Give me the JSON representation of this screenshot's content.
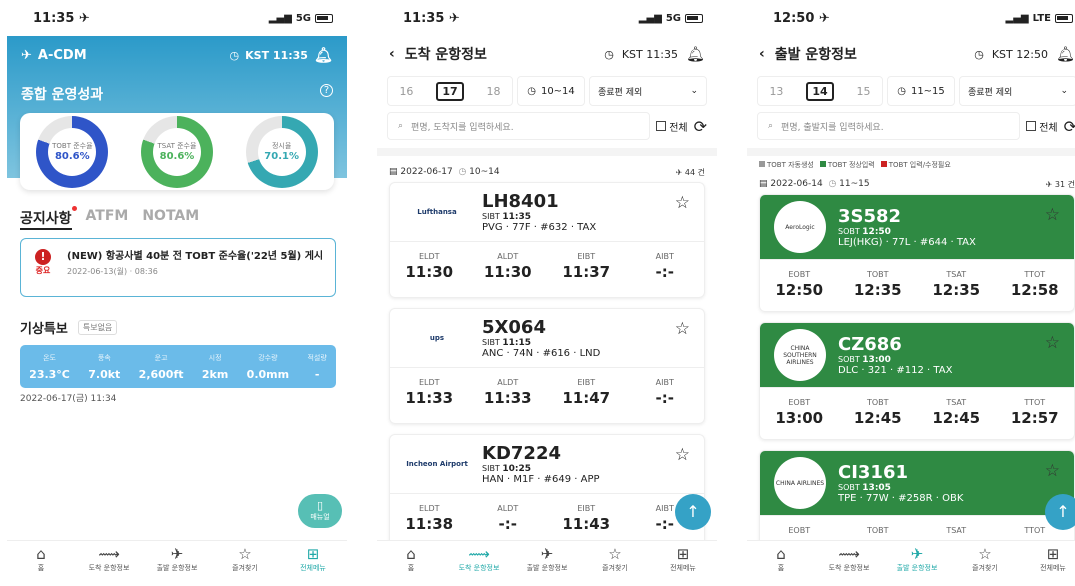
{
  "p1": {
    "status": {
      "time": "11:35 ✈",
      "signal": "5G"
    },
    "hero": {
      "logo": "A-CDM",
      "clock": "KST 11:35",
      "title": "종합 운영성과"
    },
    "donuts": [
      {
        "label": "TOBT 준수율",
        "value": "80.6%",
        "color": "#2f55c8",
        "pct": 80.6
      },
      {
        "label": "TSAT 준수율",
        "value": "80.6%",
        "color": "#4cb25c",
        "pct": 80.6
      },
      {
        "label": "정시율",
        "value": "70.1%",
        "color": "#35a8b2",
        "pct": 70.1
      }
    ],
    "tabs": [
      "공지사항",
      "ATFM",
      "NOTAM"
    ],
    "notice": {
      "badge": "중요",
      "title": "(NEW) 항공사별 40분 전 TOBT 준수율('22년 5월) 게시",
      "date": "2022-06-13(월) · 08:36"
    },
    "weather": {
      "title": "기상특보",
      "status": "특보없음",
      "items": [
        {
          "k": "온도",
          "v": "23.3°C"
        },
        {
          "k": "풍속",
          "v": "7.0kt"
        },
        {
          "k": "운고",
          "v": "2,600ft"
        },
        {
          "k": "시정",
          "v": "2km"
        },
        {
          "k": "강수량",
          "v": "0.0mm"
        },
        {
          "k": "적설량",
          "v": "-"
        }
      ],
      "time": "2022-06-17(금) 11:34"
    },
    "manual": "매뉴얼"
  },
  "nav": [
    "홈",
    "도착 운항정보",
    "출발 운항정보",
    "즐겨찾기",
    "전체메뉴"
  ],
  "p2": {
    "status": {
      "time": "11:35 ✈",
      "signal": "5G"
    },
    "title": "도착 운항정보",
    "clock": "KST 11:35",
    "dates": [
      "16",
      "17",
      "18"
    ],
    "trange": "10~14",
    "filter": "종료편 제외",
    "search_ph": "편명, 도착지를 입력하세요.",
    "all": "전체",
    "meta": {
      "date": "2022-06-17",
      "range": "10~14",
      "count": "44 건"
    },
    "cols": [
      "ELDT",
      "ALDT",
      "EIBT",
      "AIBT"
    ],
    "flights": [
      {
        "airline": "Lufthansa",
        "no": "LH8401",
        "tlabel": "SIBT",
        "t": "11:35",
        "route": "PVG · 77F · #632 · TAX",
        "v": [
          "11:30",
          "11:30",
          "11:37",
          "-:-"
        ]
      },
      {
        "airline": "ups",
        "no": "5X064",
        "tlabel": "SIBT",
        "t": "11:15",
        "route": "ANC · 74N · #616 · LND",
        "v": [
          "11:33",
          "11:33",
          "11:47",
          "-:-"
        ]
      },
      {
        "airline": "Incheon Airport",
        "no": "KD7224",
        "tlabel": "SIBT",
        "t": "10:25",
        "route": "HAN · M1F · #649 · APP",
        "v": [
          "11:38",
          "-:-",
          "11:43",
          "-:-"
        ]
      }
    ]
  },
  "p3": {
    "status": {
      "time": "12:50 ✈",
      "signal": "LTE"
    },
    "title": "출발 운항정보",
    "clock": "KST 12:50",
    "dates": [
      "13",
      "14",
      "15"
    ],
    "trange": "11~15",
    "filter": "종료편 제외",
    "search_ph": "편명, 출발지를 입력하세요.",
    "all": "전체",
    "legend": [
      {
        "t": "TOBT 자동생성",
        "c": "#999"
      },
      {
        "t": "TOBT 정상입력",
        "c": "#2f8a43"
      },
      {
        "t": "TOBT 입력/수정필요",
        "c": "#c22"
      }
    ],
    "meta": {
      "date": "2022-06-14",
      "range": "11~15",
      "count": "31 건"
    },
    "cols": [
      "EOBT",
      "TOBT",
      "TSAT",
      "TTOT"
    ],
    "flights": [
      {
        "airline": "AeroLogic",
        "no": "3S582",
        "tlabel": "SOBT",
        "t": "12:50",
        "route": "LEJ(HKG) · 77L · #644 · TAX",
        "v": [
          "12:50",
          "12:35",
          "12:35",
          "12:58"
        ]
      },
      {
        "airline": "CHINA SOUTHERN AIRLINES",
        "no": "CZ686",
        "tlabel": "SOBT",
        "t": "13:00",
        "route": "DLC · 321 · #112 · TAX",
        "v": [
          "13:00",
          "12:45",
          "12:45",
          "12:57"
        ]
      },
      {
        "airline": "CHINA AIRLINES",
        "no": "CI3161",
        "tlabel": "SOBT",
        "t": "13:05",
        "route": "TPE · 77W · #258R · OBK",
        "v": [
          "",
          "",
          "",
          ""
        ]
      }
    ]
  }
}
